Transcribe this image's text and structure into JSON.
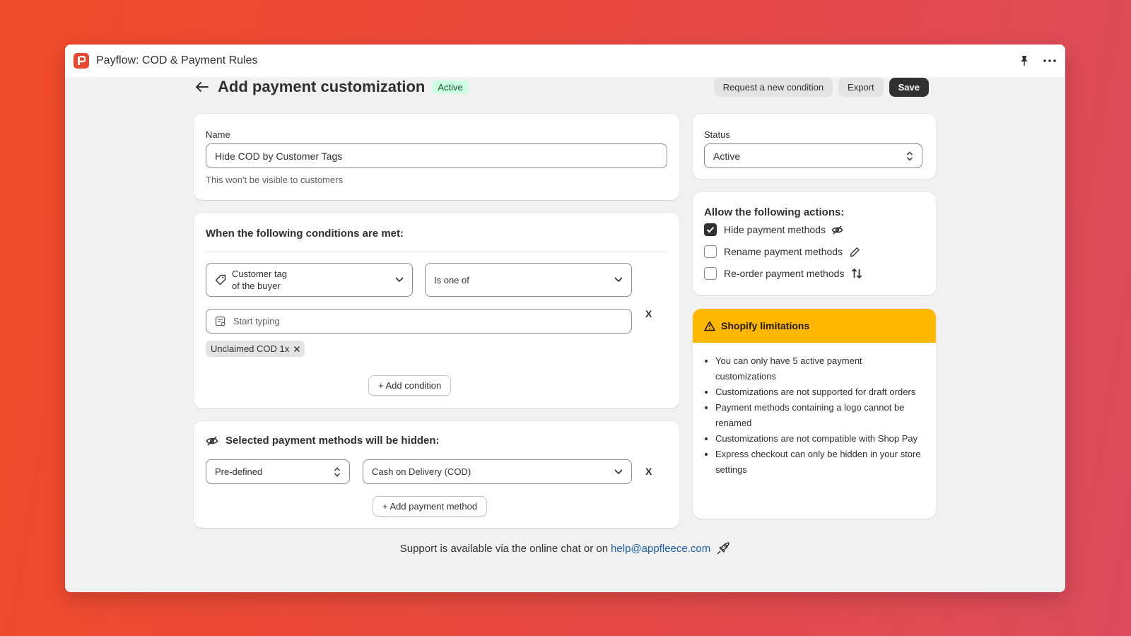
{
  "app": {
    "title": "Payflow: COD & Payment Rules",
    "logo_color": "#e8482f"
  },
  "titlebar_icons": [
    "pin-icon",
    "more-icon"
  ],
  "header": {
    "title": "Add payment customization",
    "status_badge": "Active",
    "buttons": {
      "request": "Request a new condition",
      "export": "Export",
      "save": "Save"
    }
  },
  "name_card": {
    "label": "Name",
    "value": "Hide COD by Customer Tags",
    "help": "This won't be visible to customers"
  },
  "conditions_card": {
    "title": "When the following conditions are met:",
    "condition_field": {
      "label": "Customer tag",
      "sublabel": "of the buyer",
      "icon": "tag-icon"
    },
    "operator": "Is one of",
    "input_placeholder": "Start typing",
    "remove_label": "X",
    "tags": [
      "Unclaimed COD 1x"
    ],
    "add_button": "+ Add condition"
  },
  "methods_card": {
    "title": "Selected payment methods will be hidden:",
    "type_select": "Pre-defined",
    "method_select": "Cash on Delivery (COD)",
    "remove_label": "X",
    "add_button": "+ Add payment method"
  },
  "status_card": {
    "label": "Status",
    "value": "Active"
  },
  "actions_card": {
    "title": "Allow the following actions:",
    "items": [
      {
        "label": "Hide payment methods",
        "checked": true,
        "icon": "eye-off-icon"
      },
      {
        "label": "Rename payment methods",
        "checked": false,
        "icon": "pencil-icon"
      },
      {
        "label": "Re-order payment methods",
        "checked": false,
        "icon": "sort-arrows-icon"
      }
    ]
  },
  "limitations_card": {
    "title": "Shopify limitations",
    "accent_color": "#ffb800",
    "items": [
      "You can only have 5 active payment customizations",
      "Customizations are not supported for draft orders",
      "Payment methods containing a logo cannot be renamed",
      "Customizations are not compatible with Shop Pay",
      "Express checkout can only be hidden in your store settings"
    ]
  },
  "footer": {
    "text": "Support is available via the online chat or on",
    "email": "help@appfleece.com"
  }
}
